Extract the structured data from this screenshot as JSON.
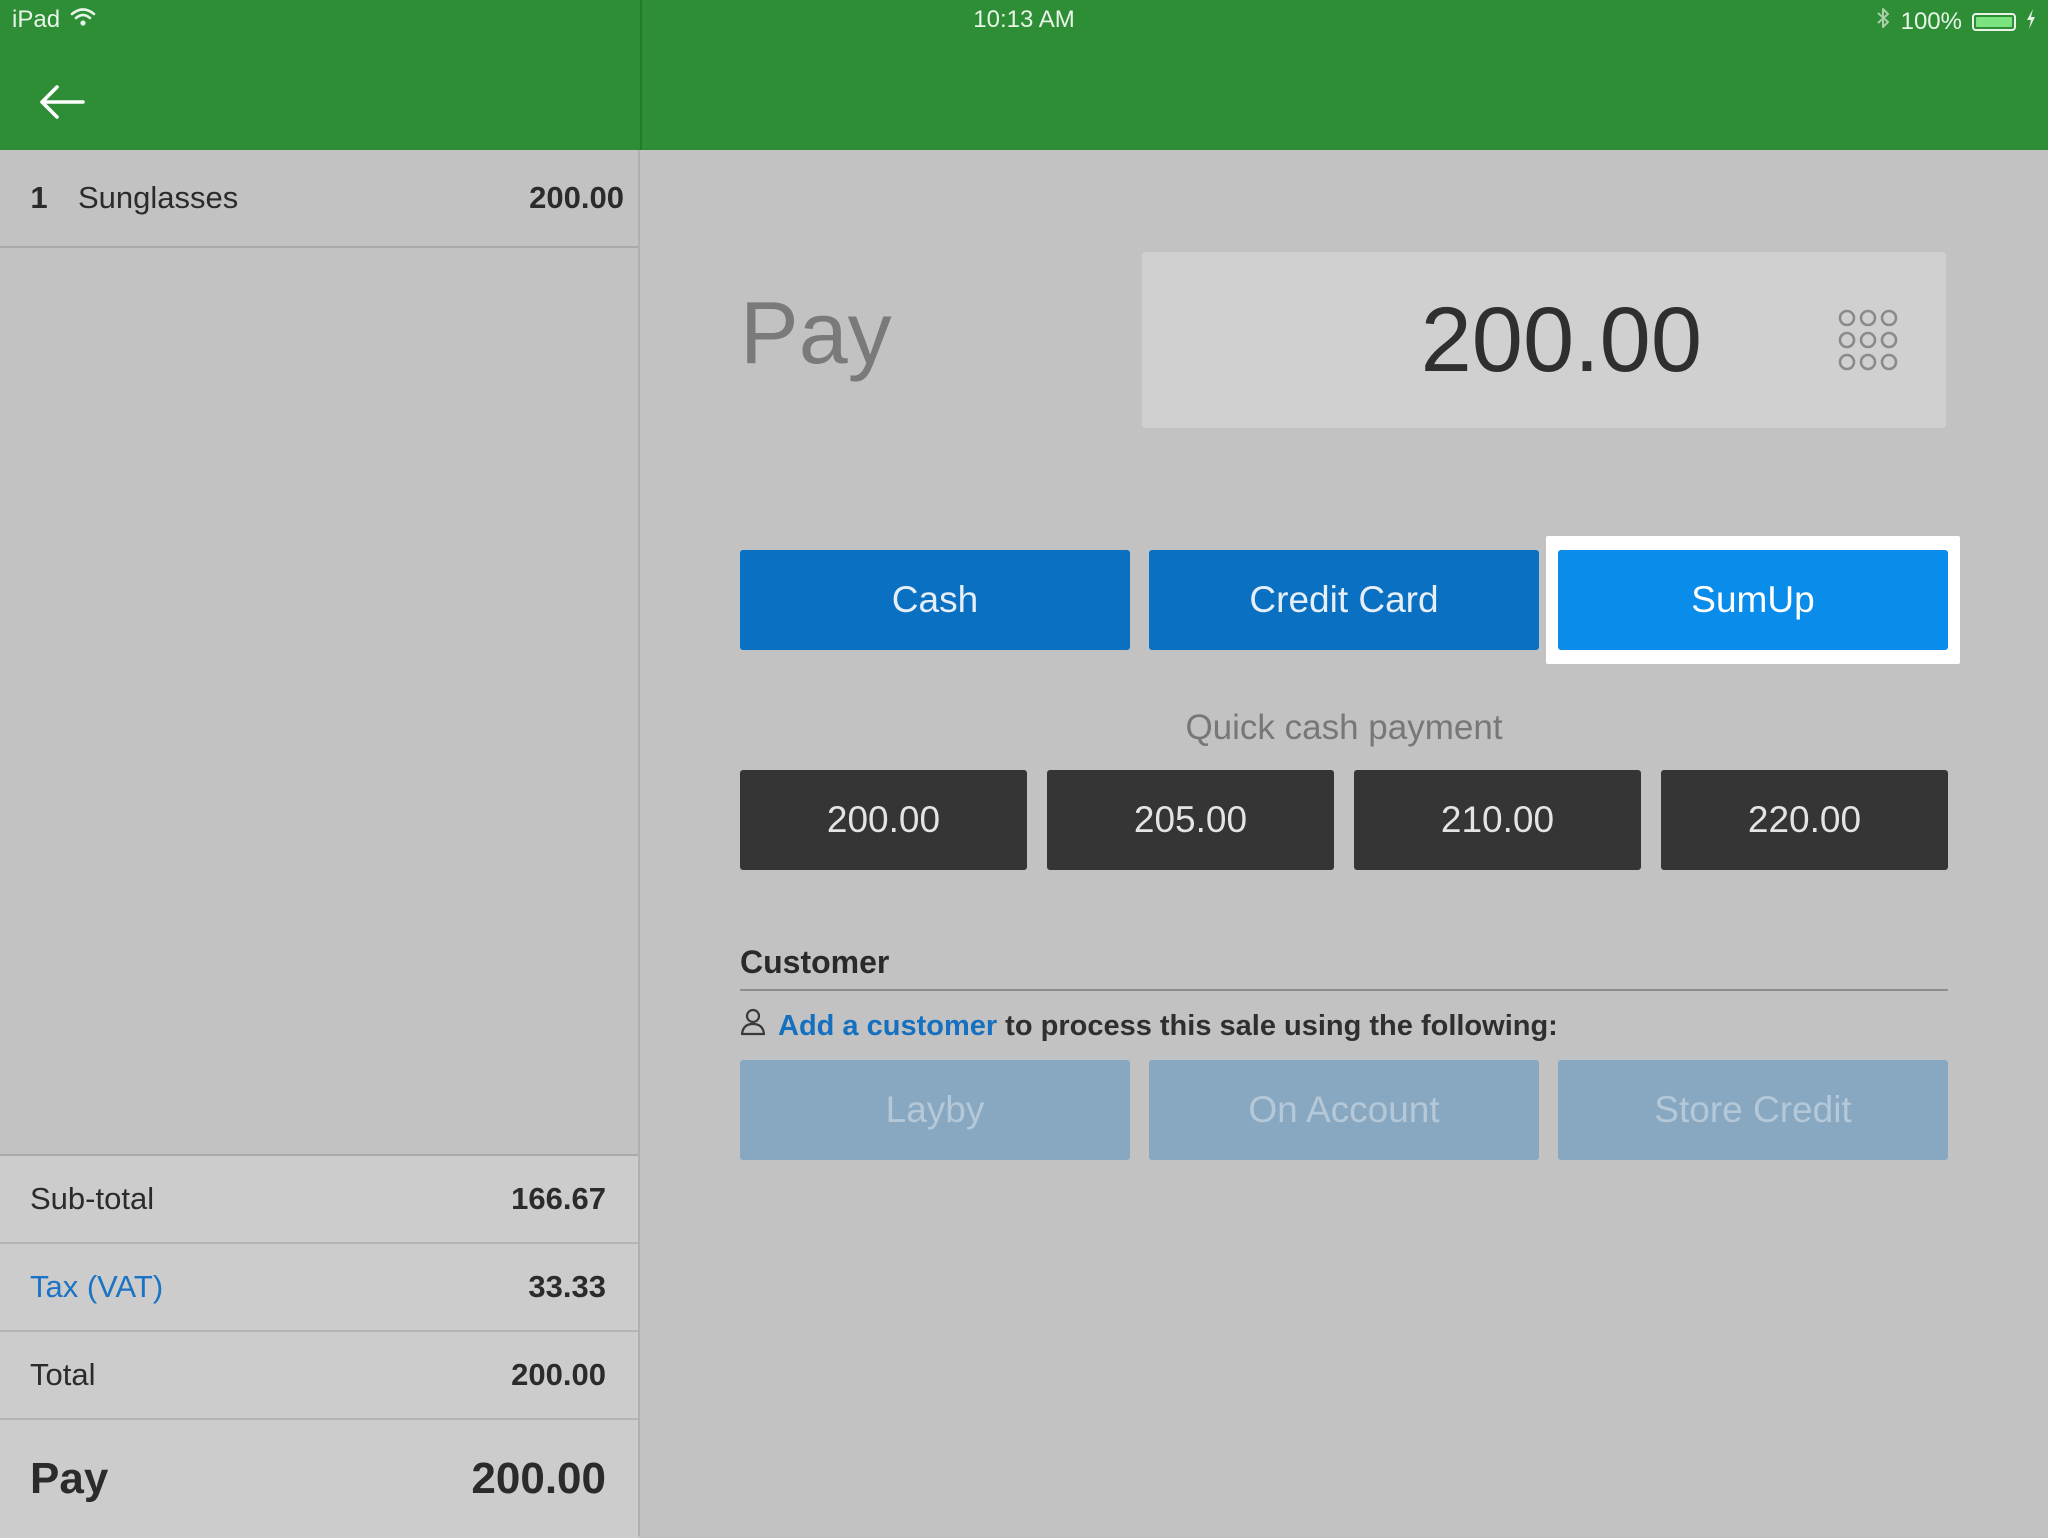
{
  "status_bar": {
    "device": "iPad",
    "time": "10:13 AM",
    "battery": "100%"
  },
  "sale": {
    "items": [
      {
        "qty": "1",
        "name": "Sunglasses",
        "price": "200.00"
      }
    ],
    "totals": {
      "subtotal_label": "Sub-total",
      "subtotal": "166.67",
      "tax_label": "Tax (VAT)",
      "tax": "33.33",
      "total_label": "Total",
      "total": "200.00",
      "pay_label": "Pay",
      "pay": "200.00"
    }
  },
  "payment": {
    "title": "Pay",
    "amount": "200.00",
    "methods": [
      "Cash",
      "Credit Card",
      "SumUp"
    ],
    "selected_method": "SumUp",
    "quick_cash_label": "Quick cash payment",
    "quick_cash": [
      "200.00",
      "205.00",
      "210.00",
      "220.00"
    ]
  },
  "customer": {
    "title": "Customer",
    "add_link": "Add a customer",
    "hint": "to process this sale using the following:",
    "options": [
      "Layby",
      "On Account",
      "Store Credit"
    ]
  },
  "colors": {
    "header_green": "#2d8e35",
    "method_blue": "#0a70c2",
    "selected_blue": "#0a8cea",
    "quick_dark": "#353535",
    "disabled_blue": "#88a8c1",
    "link_blue": "#1670c0"
  },
  "icons": {
    "back": "back-arrow-icon",
    "keypad": "keypad-icon",
    "customer": "person-icon",
    "wifi": "wifi-icon",
    "bluetooth": "bluetooth-icon",
    "battery": "battery-icon"
  }
}
